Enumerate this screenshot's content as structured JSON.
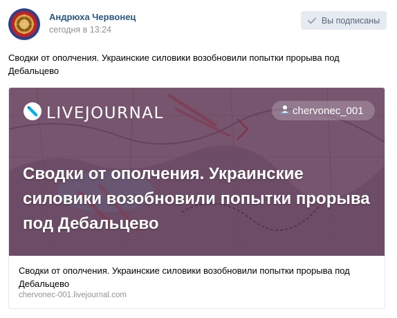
{
  "post": {
    "author": "Андрюха Червонец",
    "date": "сегодня в 13:24",
    "subscribe_label": "Вы подписаны",
    "text": "Сводки от ополчения. Украинские силовики возобновили попытки прорыва под Дебальцево"
  },
  "card": {
    "brand": "LIVEJOURNAL",
    "username": "chervonec_001",
    "heading": "Сводки от ополчения. Украинские силовики возобновили попытки прорыва под Дебальцево",
    "title": "Сводки от ополчения. Украинские силовики возобновили попытки прорыва под Дебальцево",
    "domain": "chervonec-001.livejournal.com"
  },
  "colors": {
    "author_link": "#2a5885",
    "button_bg": "#e5ebf1",
    "button_text": "#55677d",
    "muted_text": "#939393",
    "overlay": "#341438"
  },
  "icons": {
    "subscribe": "check-icon",
    "brand": "livejournal-logo-icon",
    "user": "user-icon"
  }
}
